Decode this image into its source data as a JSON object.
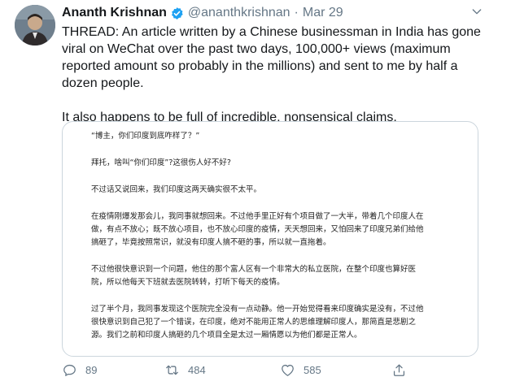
{
  "tweet": {
    "display_name": "Ananth Krishnan",
    "handle": "@ananthkrishnan",
    "separator": "·",
    "date": "Mar 29",
    "paragraphs": [
      "THREAD: An article written by a Chinese businessman in India has gone viral on WeChat over the past two days, 100,000+ views (maximum reported amount so probably in the millions) and sent to me by half a dozen people.",
      "It also happens to be full of incredible, nonsensical claims."
    ]
  },
  "media": {
    "article_paragraphs": [
      "“博主，你们印度到底咋样了？”",
      "拜托，啥叫“你们印度”?这很伤人好不好?",
      "不过话又说回来，我们印度这两天确实很不太平。",
      "在疫情刚爆发那会儿，我同事就想回来。不过他手里正好有个项目做了一大半，带着几个印度人在做，有点不放心；既不放心项目，也不放心印度的疫情，天天想回来，又怕回来了印度兄弟们给他搞砸了，毕竟按照常识，就没有印度人搞不砸的事，所以就一直拖着。",
      "不过他很快意识到一个问题，他住的那个富人区有一个非常大的私立医院，在整个印度也算好医院，所以他每天下班就去医院转转，打听下每天的疫情。",
      "过了半个月，我同事发现这个医院完全没有一点动静。他一开始觉得看来印度确实是没有，不过他很快意识到自己犯了一个错误，在印度，绝对不能用正常人的思维理解印度人，那简直是悲剧之源。我们之前和印度人搞砸的几个项目全是太过一厢情愿以为他们都是正常人。"
    ]
  },
  "actions": {
    "reply_count": "89",
    "retweet_count": "484",
    "like_count": "585"
  },
  "colors": {
    "verified": "#1da1f2",
    "muted_text": "#657786",
    "border": "#ccd6dd"
  },
  "icons": {
    "verified": "verified-badge-icon",
    "caret": "chevron-down-icon",
    "reply": "reply-icon",
    "retweet": "retweet-icon",
    "like": "heart-icon",
    "share": "share-icon"
  }
}
